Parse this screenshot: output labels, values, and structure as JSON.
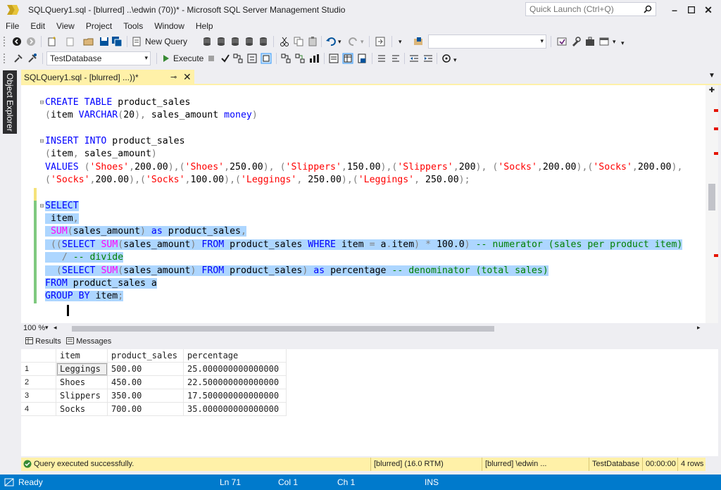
{
  "window": {
    "title": "SQLQuery1.sql - [blurred] ..\\edwin (70))* - Microsoft SQL Server Management Studio",
    "quick_launch_placeholder": "Quick Launch (Ctrl+Q)"
  },
  "menu": [
    "File",
    "Edit",
    "View",
    "Project",
    "Tools",
    "Window",
    "Help"
  ],
  "toolbar": {
    "new_query_label": "New Query",
    "database_selected": "TestDatabase",
    "execute_label": "Execute"
  },
  "side_rail": {
    "object_explorer_label": "Object Explorer"
  },
  "document_tab": {
    "label": "SQLQuery1.sql - [blurred] ...))*"
  },
  "editor": {
    "lines": [
      "CREATE TABLE product_sales",
      "(item VARCHAR(20), sales_amount money)",
      "INSERT INTO product_sales",
      "(item, sales_amount)",
      "VALUES ('Shoes',200.00),('Shoes',250.00), ('Slippers',150.00),('Slippers',200), ('Socks',200.00),('Socks',200.00),",
      "('Socks',200.00),('Socks',100.00),('Leggings', 250.00),('Leggings', 250.00);",
      "SELECT",
      " item,",
      " SUM(sales_amount) as product_sales,",
      " ((SELECT SUM(sales_amount) FROM product_sales WHERE item = a.item) * 100.0) -- numerator (sales per product item)",
      "   / -- divide",
      "  (SELECT SUM(sales_amount) FROM product_sales) as percentage -- denominator (total sales)",
      "FROM product_sales a",
      "GROUP BY item;"
    ],
    "zoom": "100 %"
  },
  "results": {
    "tabs": [
      "Results",
      "Messages"
    ],
    "columns": [
      "item",
      "product_sales",
      "percentage"
    ],
    "rows": [
      [
        "1",
        "Leggings",
        "500.00",
        "25.000000000000000"
      ],
      [
        "2",
        "Shoes",
        "450.00",
        "22.500000000000000"
      ],
      [
        "3",
        "Slippers",
        "350.00",
        "17.500000000000000"
      ],
      [
        "4",
        "Socks",
        "700.00",
        "35.000000000000000"
      ]
    ]
  },
  "query_status": {
    "message": "Query executed successfully.",
    "server": "[blurred] (16.0 RTM)",
    "login": "[blurred] \\edwin ...",
    "database": "TestDatabase",
    "elapsed": "00:00:00",
    "rows": "4 rows"
  },
  "app_status": {
    "ready": "Ready",
    "line": "Ln 71",
    "col": "Col 1",
    "ch": "Ch 1",
    "mode": "INS"
  }
}
